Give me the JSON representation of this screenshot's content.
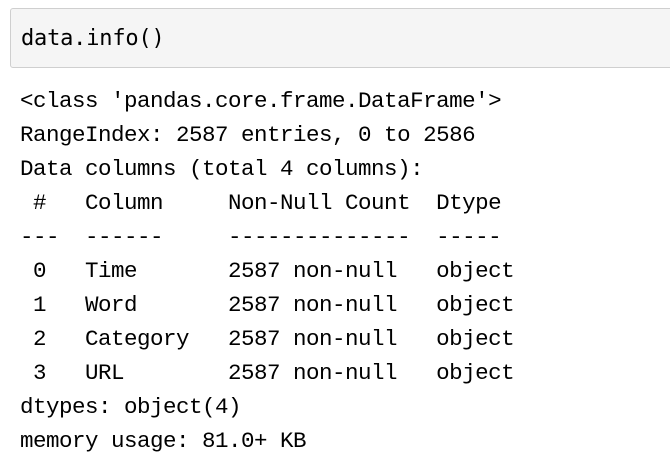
{
  "input_cell": {
    "code": "data.info()"
  },
  "output": {
    "lines": [
      "<class 'pandas.core.frame.DataFrame'>",
      "RangeIndex: 2587 entries, 0 to 2586",
      "Data columns (total 4 columns):",
      " #   Column     Non-Null Count  Dtype ",
      "---  ------     --------------  ----- ",
      " 0   Time       2587 non-null   object",
      " 1   Word       2587 non-null   object",
      " 2   Category   2587 non-null   object",
      " 3   URL        2587 non-null   object",
      "dtypes: object(4)",
      "memory usage: 81.0+ KB"
    ]
  }
}
